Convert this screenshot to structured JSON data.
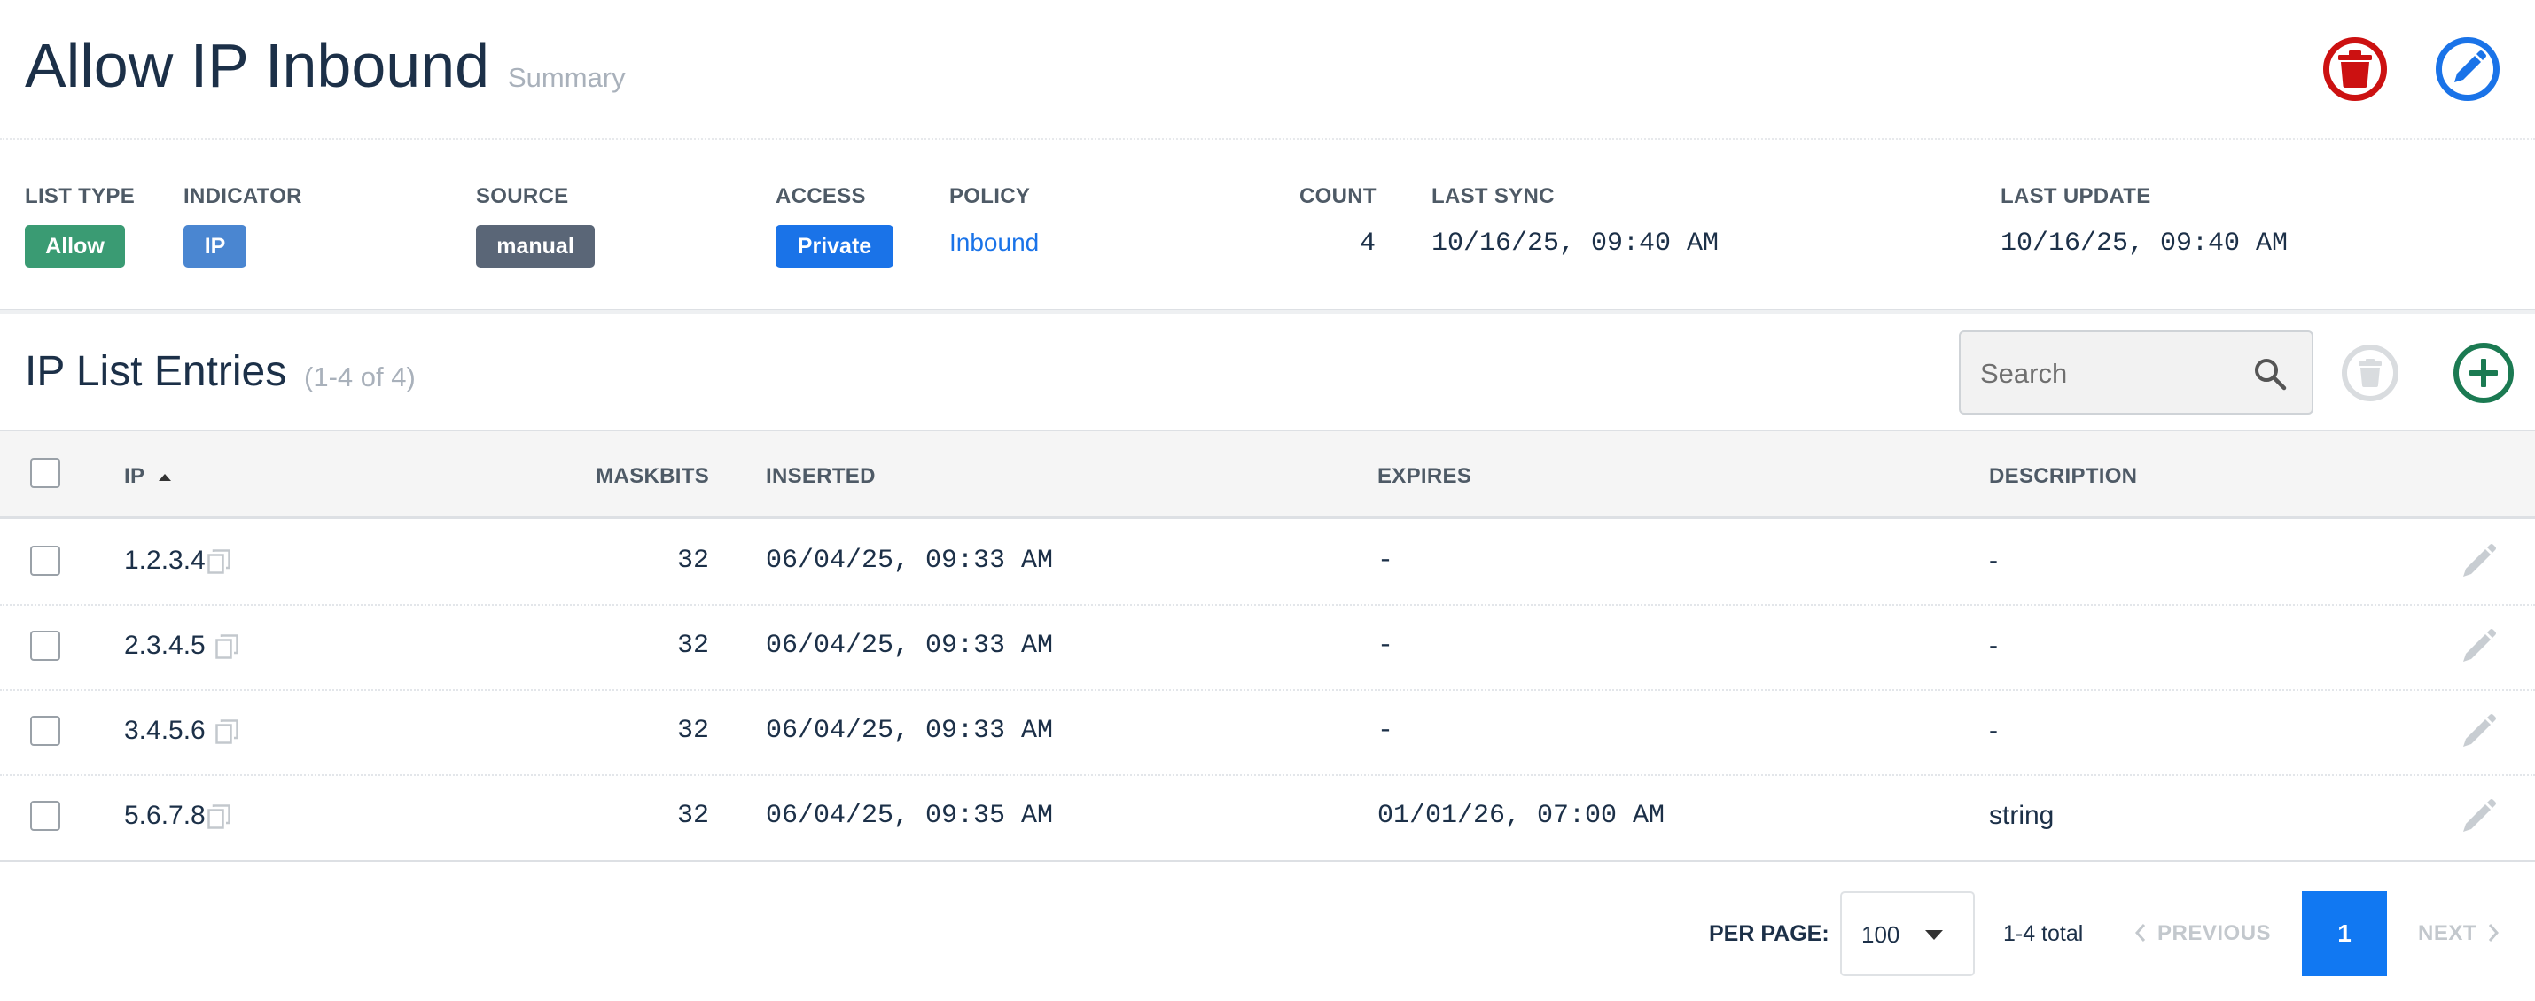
{
  "header": {
    "title": "Allow IP Inbound",
    "subtitle": "Summary"
  },
  "summary": {
    "list_type": {
      "label": "LIST TYPE",
      "value": "Allow",
      "color": "#3a9b73"
    },
    "indicator": {
      "label": "INDICATOR",
      "value": "IP",
      "color": "#4a86d1"
    },
    "source": {
      "label": "SOURCE",
      "value": "manual",
      "color": "#5a6677"
    },
    "access": {
      "label": "ACCESS",
      "value": "Private",
      "color": "#1a73e8"
    },
    "policy": {
      "label": "POLICY",
      "value": "Inbound"
    },
    "count": {
      "label": "COUNT",
      "value": "4"
    },
    "last_sync": {
      "label": "LAST SYNC",
      "value": "10/16/25, 09:40 AM"
    },
    "last_update": {
      "label": "LAST UPDATE",
      "value": "10/16/25, 09:40 AM"
    }
  },
  "entries": {
    "title": "IP List Entries",
    "range": "(1-4 of 4)",
    "search_placeholder": "Search",
    "columns": {
      "ip": "IP",
      "maskbits": "MASKBITS",
      "inserted": "INSERTED",
      "expires": "EXPIRES",
      "description": "DESCRIPTION"
    },
    "sort": {
      "column": "IP",
      "direction": "ascending"
    },
    "rows": [
      {
        "ip": "1.2.3.4",
        "maskbits": "32",
        "inserted": "06/04/25, 09:33 AM",
        "expires": "-",
        "description": "-"
      },
      {
        "ip": "2.3.4.5",
        "maskbits": "32",
        "inserted": "06/04/25, 09:33 AM",
        "expires": "-",
        "description": "-"
      },
      {
        "ip": "3.4.5.6",
        "maskbits": "32",
        "inserted": "06/04/25, 09:33 AM",
        "expires": "-",
        "description": "-"
      },
      {
        "ip": "5.6.7.8",
        "maskbits": "32",
        "inserted": "06/04/25, 09:35 AM",
        "expires": "01/01/26, 07:00 AM",
        "description": "string"
      }
    ]
  },
  "pagination": {
    "per_page_label": "PER PAGE:",
    "per_page_value": "100",
    "total": "1-4 total",
    "previous": "PREVIOUS",
    "current_page": "1",
    "next": "NEXT"
  },
  "icons": {
    "delete_list": "trash-icon",
    "edit_list": "pencil-circle-icon",
    "search": "search-icon",
    "bulk_delete": "trash-icon",
    "add_entry": "plus-circle-icon",
    "copy": "clipboard-icon",
    "edit_row": "pencil-icon"
  },
  "colors": {
    "danger": "#cc1111",
    "primary": "#1a73e8",
    "success": "#1b7a52",
    "text": "#1c3048",
    "muted": "#a9b1bb"
  }
}
